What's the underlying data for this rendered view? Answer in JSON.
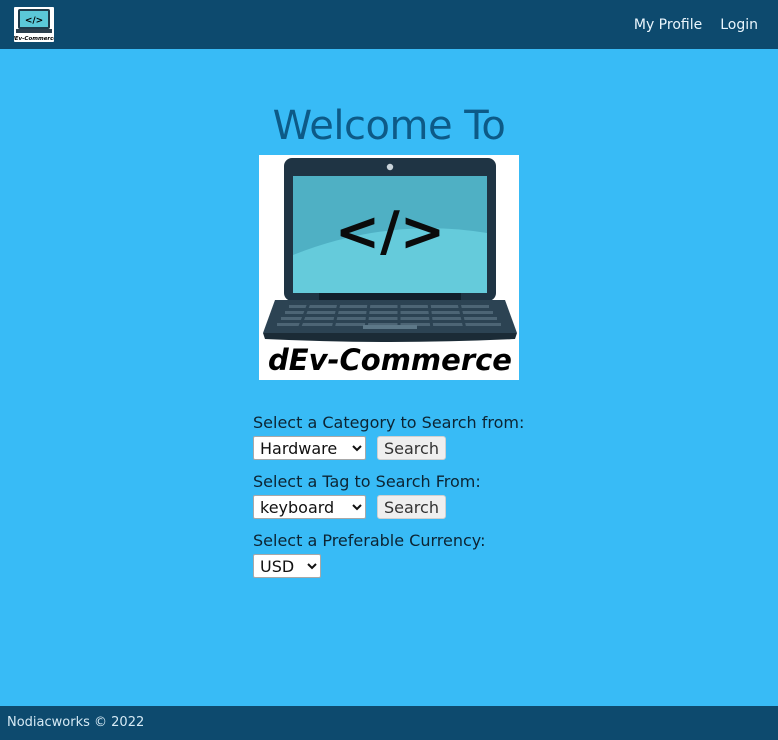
{
  "navbar": {
    "logo_icon": "dev-commerce-logo-icon",
    "links": {
      "profile": "My Profile",
      "login": "Login"
    }
  },
  "hero": {
    "title": "Welcome To",
    "logo_text": "dEv-Commerce",
    "logo_code_glyph": "</>"
  },
  "form": {
    "category": {
      "label": "Select a Category to Search from:",
      "selected": "Hardware",
      "button": "Search"
    },
    "tag": {
      "label": "Select a Tag to Search From:",
      "selected": "keyboard",
      "button": "Search"
    },
    "currency": {
      "label": "Select a Preferable Currency:",
      "selected": "USD"
    }
  },
  "footer": {
    "text": "Nodiacworks © 2022"
  },
  "colors": {
    "navbar": "#0d4a6e",
    "background": "#38bbf6",
    "title": "#0d5a87",
    "screen": "#5bc8d8"
  }
}
